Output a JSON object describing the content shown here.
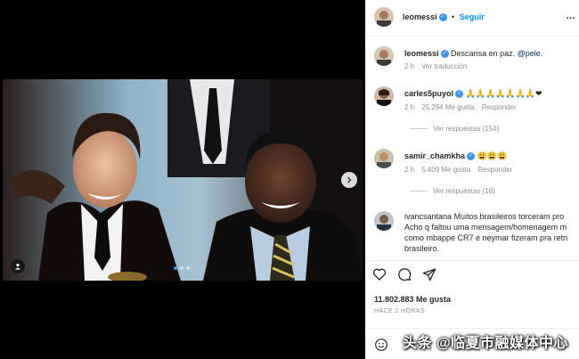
{
  "post": {
    "username": "leomessi",
    "follow_label": "Seguir",
    "caption_text": "Descansa en paz.",
    "caption_mention": "@pele",
    "caption_tail": ".",
    "caption_time": "2 h",
    "translate_label": "Ver traducción",
    "likes": "11.802.883 Me gusta",
    "time_ago": "HACE 2 HORAS",
    "carousel_dots": 3,
    "active_dot": 0
  },
  "comments": [
    {
      "username": "carles5puyol",
      "text": "🙏🙏🙏🙏🙏🙏🙏❤",
      "time": "2 h",
      "likes": "25.294 Me gusta",
      "reply": "Responder",
      "view_replies": "Ver respuestas (154)"
    },
    {
      "username": "samir_chamkha",
      "text": "😩😩😩",
      "time": "2 h",
      "likes": "5.409 Me gusta",
      "reply": "Responder",
      "view_replies": "Ver respuestas (16)"
    },
    {
      "username": "ivancsantana",
      "text_lines": [
        "Muitos brasileiros torceram pro",
        "Acho q faltou uma mensagem/homenagem m",
        "como mbappe CR7 e neymar fizeram pra retri",
        "brasileiro."
      ]
    }
  ],
  "icons": {
    "like": "heart-icon",
    "comment": "comment-icon",
    "share": "send-icon",
    "emoji": "smiley-icon",
    "next": "chevron-right-icon",
    "tag": "user-tag-icon"
  },
  "colors": {
    "accent": "#0095f6",
    "verified": "#3897f0"
  },
  "watermark": "头条 @临夏市融媒体中心"
}
